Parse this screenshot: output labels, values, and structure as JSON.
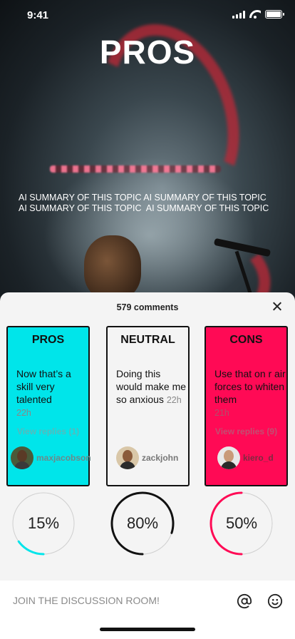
{
  "status_bar": {
    "time": "9:41"
  },
  "hero": {
    "title": "PROS",
    "summary_line1": "AI SUMMARY OF THIS TOPIC AI SUMMARY OF THIS TOPIC",
    "summary_line2": "AI SUMMARY OF THIS TOPIC  AI SUMMARY OF THIS TOPIC"
  },
  "sheet": {
    "comments_count": "579 comments",
    "cards": [
      {
        "title": "PROS",
        "comment": "Now that’s a skill very talented",
        "ago": "22h",
        "replies": "View replies (1)",
        "username": "maxjacobson",
        "color": "#00e5ea"
      },
      {
        "title": "NEUTRAL",
        "comment": "Doing this would make me so anxious",
        "ago": "22h",
        "replies": "",
        "username": "zackjohn",
        "color": "#f4f4f4"
      },
      {
        "title": "CONS",
        "comment": "Use that on r air forces to whiten them",
        "ago": "21h",
        "replies": "View replies (9)",
        "username": "kiero_d",
        "color": "#ff0a55"
      }
    ],
    "gauges": [
      {
        "label": "15%",
        "value": 0.15,
        "color": "#00e5ea"
      },
      {
        "label": "80%",
        "value": 0.8,
        "color": "#111111"
      },
      {
        "label": "50%",
        "value": 0.5,
        "color": "#ff0a55"
      }
    ]
  },
  "bottom_bar": {
    "input_placeholder": "JOIN THE DISCUSSION ROOM!",
    "mention_icon": "at-sign-icon",
    "emoji_icon": "smiley-icon"
  }
}
